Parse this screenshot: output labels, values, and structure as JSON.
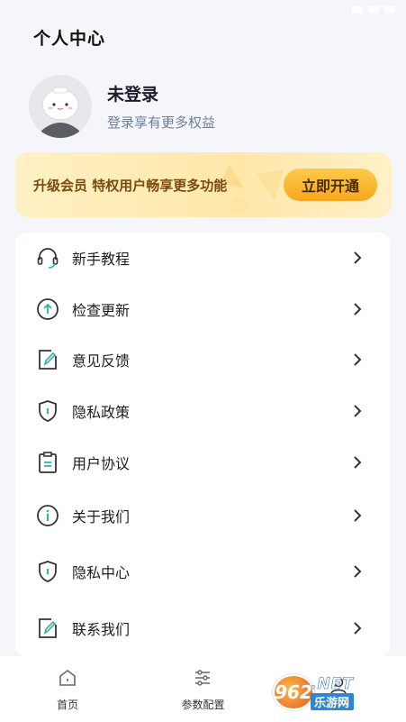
{
  "header": {
    "title": "个人中心"
  },
  "profile": {
    "name": "未登录",
    "subtitle": "登录享有更多权益"
  },
  "vip": {
    "text": "升级会员 特权用户畅享更多功能",
    "button": "立即开通"
  },
  "menu": [
    {
      "label": "新手教程",
      "icon": "headset-icon"
    },
    {
      "label": "检查更新",
      "icon": "arrow-up-circle-icon"
    },
    {
      "label": "意见反馈",
      "icon": "edit-icon"
    },
    {
      "label": "隐私政策",
      "icon": "shield-icon"
    },
    {
      "label": "用户协议",
      "icon": "clipboard-icon"
    },
    {
      "label": "关于我们",
      "icon": "info-icon"
    },
    {
      "label": "隐私中心",
      "icon": "shield-icon"
    },
    {
      "label": "联系我们",
      "icon": "edit-icon"
    }
  ],
  "tabs": [
    {
      "label": "首页",
      "icon": "home-icon"
    },
    {
      "label": "参数配置",
      "icon": "sliders-icon"
    },
    {
      "label": "",
      "icon": "user-icon"
    }
  ],
  "watermark": {
    "number": "962",
    "net": ".NET",
    "cn": "乐游网"
  },
  "colors": {
    "accent": "#2bb5a5",
    "vip_button": "#f5a81c",
    "vip_text": "#7b4a10"
  }
}
